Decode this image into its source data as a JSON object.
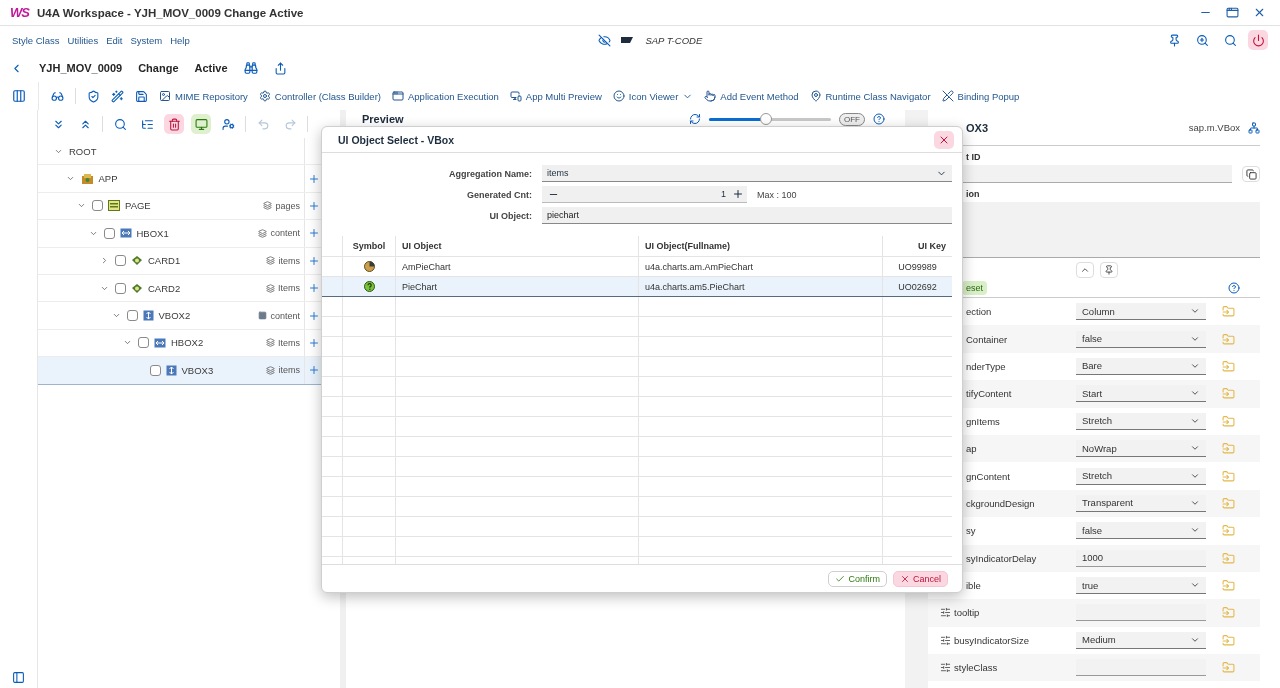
{
  "window": {
    "logo": "WS",
    "title": "U4A Workspace - YJH_MOV_0009 Change Active"
  },
  "menu": [
    "Style Class",
    "Utilities",
    "Edit",
    "System",
    "Help"
  ],
  "tcode": {
    "placeholder": "SAP T-CODE"
  },
  "header": {
    "name": "YJH_MOV_0009",
    "mode": "Change",
    "status": "Active"
  },
  "toolbar": [
    {
      "label": "MIME Repository",
      "dropdown": false
    },
    {
      "label": "Controller (Class Builder)",
      "dropdown": false
    },
    {
      "label": "Application Execution",
      "dropdown": false
    },
    {
      "label": "App Multi Preview",
      "dropdown": false
    },
    {
      "label": "Icon Viewer",
      "dropdown": true
    },
    {
      "label": "Add Event Method",
      "dropdown": false
    },
    {
      "label": "Runtime Class Navigator",
      "dropdown": false
    },
    {
      "label": "Binding Popup",
      "dropdown": false
    }
  ],
  "tree": [
    {
      "label": "ROOT",
      "kind": "root",
      "expanded": true,
      "selected": false,
      "children": [
        {
          "label": "APP",
          "kind": "app",
          "expanded": true,
          "selected": false,
          "children": [
            {
              "label": "PAGE",
              "kind": "page",
              "checked": false,
              "expanded": true,
              "selected": false,
              "aggregation": {
                "label": "pages",
                "kind": "multiple"
              },
              "children": [
                {
                  "label": "HBOX1",
                  "kind": "hbox",
                  "checked": false,
                  "expanded": true,
                  "selected": false,
                  "aggregation": {
                    "label": "content",
                    "kind": "multiple"
                  },
                  "children": [
                    {
                      "label": "CARD1",
                      "kind": "card",
                      "checked": false,
                      "expanded": false,
                      "selected": false,
                      "aggregation": {
                        "label": "items",
                        "kind": "multiple"
                      }
                    },
                    {
                      "label": "CARD2",
                      "kind": "card",
                      "checked": false,
                      "expanded": true,
                      "selected": false,
                      "aggregation": {
                        "label": "Items",
                        "kind": "multiple"
                      },
                      "children": [
                        {
                          "label": "VBOX2",
                          "kind": "vbox",
                          "checked": false,
                          "expanded": true,
                          "selected": false,
                          "aggregation": {
                            "label": "content",
                            "kind": "single"
                          },
                          "children": [
                            {
                              "label": "HBOX2",
                              "kind": "hbox",
                              "checked": false,
                              "expanded": true,
                              "selected": false,
                              "aggregation": {
                                "label": "Items",
                                "kind": "multiple"
                              },
                              "children": [
                                {
                                  "label": "VBOX3",
                                  "kind": "vbox",
                                  "checked": false,
                                  "selected": true,
                                  "aggregation": {
                                    "label": "items",
                                    "kind": "multiple"
                                  }
                                }
                              ]
                            }
                          ]
                        }
                      ]
                    }
                  ]
                }
              ]
            }
          ]
        }
      ]
    }
  ],
  "preview": {
    "title": "Preview",
    "zoom": {
      "level": 0.47
    },
    "switch": {
      "label": "OFF",
      "on": false
    }
  },
  "dialog": {
    "title": "UI Object Select - VBox",
    "fields": [
      {
        "label": "Aggregation Name:",
        "kind": "select",
        "value": "items"
      },
      {
        "label": "Generated Cnt:",
        "kind": "stepper",
        "value": "1",
        "note": "Max : 100"
      },
      {
        "label": "UI Object:",
        "kind": "input",
        "value": "piechart"
      }
    ],
    "columns": [
      "Symbol",
      "UI Object",
      "UI Object(Fullname)",
      "UI Key"
    ],
    "rows": [
      {
        "kind": "ampie",
        "name": "AmPieChart",
        "fullname": "u4a.charts.am.AmPieChart",
        "key": "UO99989",
        "selected": false
      },
      {
        "kind": "pie",
        "name": "PieChart",
        "fullname": "u4a.charts.am5.PieChart",
        "key": "UO02692",
        "selected": true
      }
    ],
    "buttons": [
      {
        "label": "Confirm",
        "kind": "accept"
      },
      {
        "label": "Cancel",
        "kind": "reject"
      }
    ]
  },
  "properties": {
    "title": "OX3",
    "class_name": "sap.m.VBox",
    "id_label": "t ID",
    "description_label": "ion",
    "reset": "eset",
    "rows": [
      {
        "name": "ection",
        "kind": "select",
        "value": "Column",
        "marker": false
      },
      {
        "name": "Container",
        "kind": "select",
        "value": "false",
        "marker": false
      },
      {
        "name": "nderType",
        "kind": "select",
        "value": "Bare",
        "marker": false
      },
      {
        "name": "tifyContent",
        "kind": "select",
        "value": "Start",
        "marker": false
      },
      {
        "name": "gnItems",
        "kind": "select",
        "value": "Stretch",
        "marker": false
      },
      {
        "name": "ap",
        "kind": "select",
        "value": "NoWrap",
        "marker": false
      },
      {
        "name": "gnContent",
        "kind": "select",
        "value": "Stretch",
        "marker": false
      },
      {
        "name": "ckgroundDesign",
        "kind": "select",
        "value": "Transparent",
        "marker": false
      },
      {
        "name": "sy",
        "kind": "select",
        "value": "false",
        "marker": false
      },
      {
        "name": "syIndicatorDelay",
        "kind": "input",
        "value": "1000",
        "marker": false
      },
      {
        "name": "ible",
        "kind": "select",
        "value": "true",
        "marker": false
      },
      {
        "name": "tooltip",
        "kind": "input",
        "value": "",
        "marker": true
      },
      {
        "name": "busyIndicatorSize",
        "kind": "select",
        "value": "Medium",
        "marker": true
      },
      {
        "name": "styleClass",
        "kind": "input",
        "value": "",
        "marker": true
      }
    ]
  }
}
